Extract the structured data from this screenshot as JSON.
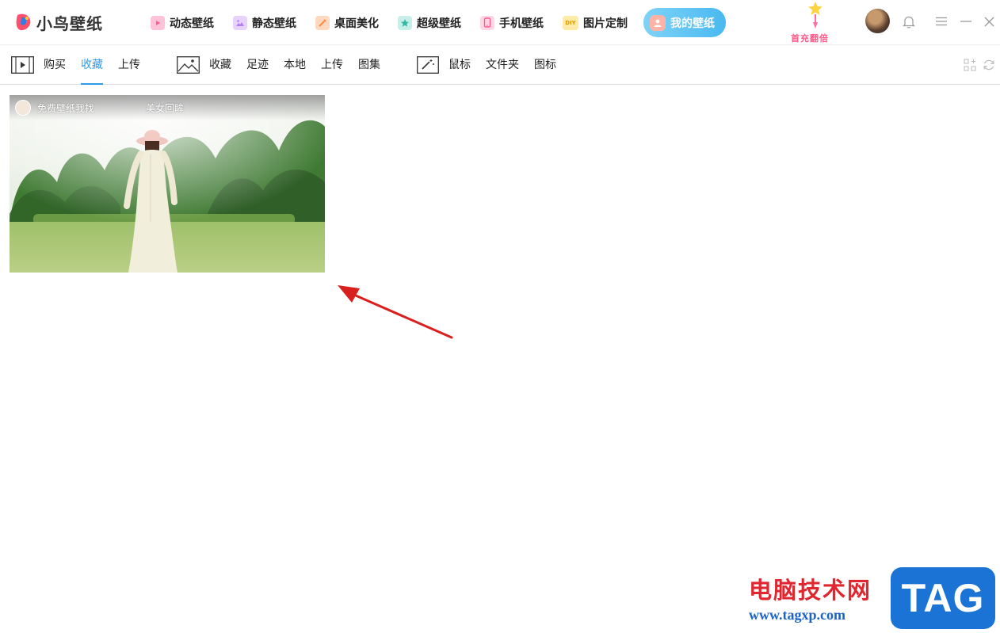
{
  "app": {
    "logo_text": "小鸟壁纸"
  },
  "nav": {
    "items": [
      {
        "label": "动态壁纸",
        "icon": "play-icon",
        "color": "#ff8fb3"
      },
      {
        "label": "静态壁纸",
        "icon": "image-icon",
        "color": "#c99af2"
      },
      {
        "label": "桌面美化",
        "icon": "brush-icon",
        "color": "#ffb27a"
      },
      {
        "label": "超级壁纸",
        "icon": "star-icon",
        "color": "#4fcfbd"
      },
      {
        "label": "手机壁纸",
        "icon": "phone-icon",
        "color": "#ff8fb3"
      },
      {
        "label": "图片定制",
        "icon": "diy-icon",
        "color": "#ffcc66",
        "icon_text": "DIY"
      },
      {
        "label": "我的壁纸",
        "icon": "user-icon",
        "color": "#ff9a8a",
        "active": true
      }
    ]
  },
  "promo": {
    "text": "首充翻倍"
  },
  "subnav": {
    "video_group": [
      "购买",
      "收藏",
      "上传"
    ],
    "image_group": [
      "收藏",
      "足迹",
      "本地",
      "上传",
      "图集"
    ],
    "cursor_group": [
      "鼠标",
      "文件夹",
      "图标"
    ],
    "active": "video_group.1"
  },
  "cards": [
    {
      "author": "免费壁纸我找",
      "title": "美女回眸"
    }
  ],
  "watermark": {
    "cn": "电脑技术网",
    "url": "www.tagxp.com",
    "tag": "TAG"
  },
  "colors": {
    "accent": "#2f9be6",
    "active_nav_gradient": [
      "#7fd3f7",
      "#49b9f0"
    ],
    "annotation_arrow": "#d9201f"
  }
}
